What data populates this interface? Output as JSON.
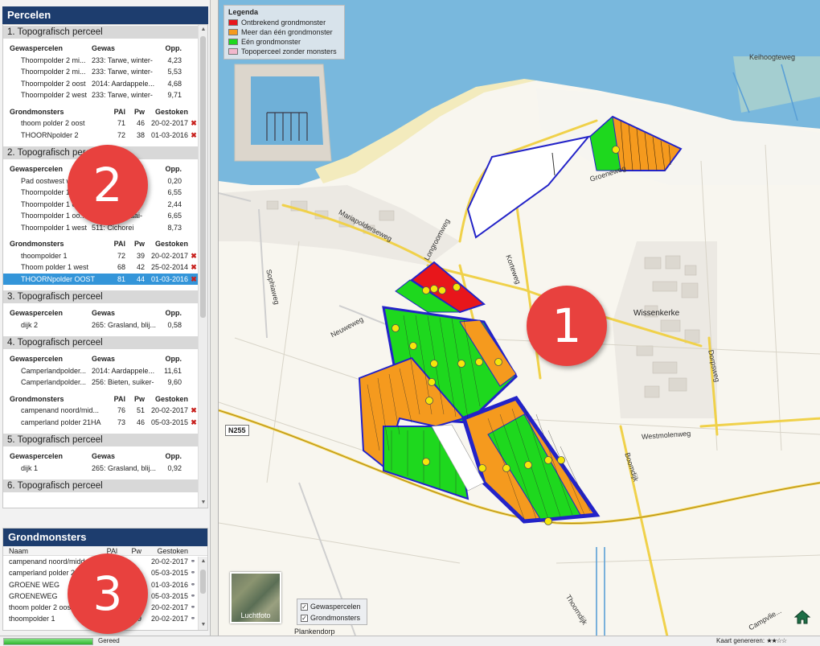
{
  "percelen_panel": {
    "title": "Percelen",
    "sections": [
      {
        "title": "1. Topografisch perceel",
        "gewas_headers": [
          "Gewaspercelen",
          "Gewas",
          "Opp."
        ],
        "gewaspercelen": [
          [
            "Thoornpolder 2 mi...",
            "233: Tarwe, winter-",
            "4,23"
          ],
          [
            "Thoornpolder 2 mi...",
            "233: Tarwe, winter-",
            "5,53"
          ],
          [
            "Thoornpolder 2 oost",
            "2014: Aardappele...",
            "4,68"
          ],
          [
            "Thoornpolder 2 west",
            "233: Tarwe, winter-",
            "9,71"
          ]
        ],
        "grond_headers": [
          "Grondmonsters",
          "PAl",
          "Pw",
          "Gestoken"
        ],
        "grondmonsters": [
          [
            "thoom polder 2 oost",
            "71",
            "46",
            "20-02-2017"
          ],
          [
            "THOORNpolder 2",
            "72",
            "38",
            "01-03-2016"
          ]
        ]
      },
      {
        "title": "2. Topografisch perceel",
        "gewas_headers": [
          "Gewaspercelen",
          "Gewas",
          "Opp."
        ],
        "gewaspercelen": [
          [
            "Pad oostwest w...",
            "",
            "0,20"
          ],
          [
            "Thoornpolder 1 mi...",
            "...s (",
            "6,55"
          ],
          [
            "Thoornpolder 1 oost",
            "...zomer-",
            "2,44"
          ],
          [
            "Thoornpolder 1 oo...",
            "262: Uien, zaai-",
            "6,65"
          ],
          [
            "Thoornpolder 1 west",
            "511: Cichorei",
            "8,73"
          ]
        ],
        "grond_headers": [
          "Grondmonsters",
          "PAl",
          "Pw",
          "Gestoken"
        ],
        "grondmonsters": [
          [
            "thoompolder 1",
            "72",
            "39",
            "20-02-2017"
          ],
          [
            "Thoom polder 1 west",
            "68",
            "42",
            "25-02-2014"
          ],
          [
            "THOORNpolder OOST",
            "81",
            "44",
            "01-03-2016"
          ]
        ]
      },
      {
        "title": "3. Topografisch perceel",
        "gewas_headers": [
          "Gewaspercelen",
          "Gewas",
          "Opp."
        ],
        "gewaspercelen": [
          [
            "dijk 2",
            "265: Grasland, blij...",
            "0,58"
          ]
        ]
      },
      {
        "title": "4. Topografisch perceel",
        "gewas_headers": [
          "Gewaspercelen",
          "Gewas",
          "Opp."
        ],
        "gewaspercelen": [
          [
            "Camperlandpolder...",
            "2014: Aardappele...",
            "11,61"
          ],
          [
            "Camperlandpolder...",
            "256: Bieten, suiker-",
            "9,60"
          ]
        ],
        "grond_headers": [
          "Grondmonsters",
          "PAl",
          "Pw",
          "Gestoken"
        ],
        "grondmonsters": [
          [
            "campenand noord/mid...",
            "76",
            "51",
            "20-02-2017"
          ],
          [
            "camperland polder 21HA",
            "73",
            "46",
            "05-03-2015"
          ]
        ]
      },
      {
        "title": "5. Topografisch perceel",
        "gewas_headers": [
          "Gewaspercelen",
          "Gewas",
          "Opp."
        ],
        "gewaspercelen": [
          [
            "dijk 1",
            "265: Grasland, blij...",
            "0,92"
          ]
        ]
      },
      {
        "title": "6. Topografisch perceel"
      }
    ]
  },
  "grondmonsters_panel": {
    "title": "Grondmonsters",
    "headers": [
      "Naam",
      "PAl",
      "Pw",
      "Gestoken"
    ],
    "rows": [
      [
        "campenand noord/midd...",
        "",
        "",
        "20-02-2017"
      ],
      [
        "camperland polder 2...",
        "",
        "",
        "05-03-2015"
      ],
      [
        "GROENE WEG",
        "",
        "",
        "01-03-2016"
      ],
      [
        "GROENEWEG",
        "",
        "",
        "05-03-2015"
      ],
      [
        "thoom polder 2 oost",
        "",
        "",
        "20-02-2017"
      ],
      [
        "thoompolder 1",
        "",
        "39",
        "20-02-2017"
      ]
    ]
  },
  "map": {
    "legend": {
      "title": "Legenda",
      "items": [
        {
          "label": "Ontbrekend grondmonster",
          "color": "#e8161b"
        },
        {
          "label": "Meer dan één grondmonster",
          "color": "#f59a1e"
        },
        {
          "label": "Eén grondmonster",
          "color": "#1ed81e"
        },
        {
          "label": "Topoperceel zonder monsters",
          "color": "#f2b8cc"
        }
      ]
    },
    "road_labels": [
      "Keihoogteweg",
      "Groeneweg",
      "Mariapolderseweg",
      "Longroomweg",
      "Korteweg",
      "Sophiaweg",
      "Neuweweg",
      "Westmolenweg",
      "Dorpsweg",
      "Boomdijk",
      "Thoorndijk",
      "Campvlie..."
    ],
    "town_labels": [
      "Wissenkerke",
      "Plankendorp"
    ],
    "road_number": "N255",
    "luchtfoto_label": "Luchtfoto",
    "layers": [
      {
        "label": "Gewaspercelen",
        "checked": "✓"
      },
      {
        "label": "Grondmonsters",
        "checked": "✓"
      }
    ],
    "home_icon": "home-icon"
  },
  "annotations": [
    "1",
    "2",
    "3"
  ],
  "statusbar": {
    "progress_fraction": 1.0,
    "status_text": "Gereed",
    "kaart_label": "Kaart genereren:",
    "stars": "★★☆☆"
  },
  "colors": {
    "panel_title_bg": "#1d3d6e",
    "selected_row_bg": "#3395d9",
    "badge": "#e8413e",
    "water": "#79b8dd"
  }
}
